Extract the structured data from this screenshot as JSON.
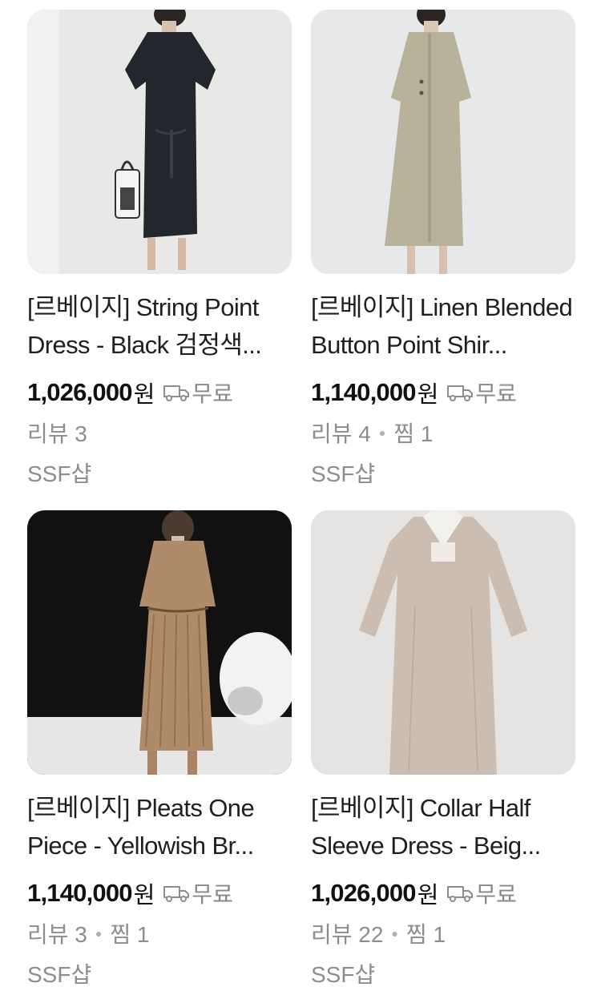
{
  "products": [
    {
      "title": "[르베이지] String Point Dress - Black 검정색...",
      "price": "1,026,000",
      "currency": "원",
      "shipping": "무료",
      "reviews": "리뷰 3",
      "likes": "",
      "store": "SSF샵",
      "image": "black-dress-photo"
    },
    {
      "title": "[르베이지] Linen Blended Button Point Shir...",
      "price": "1,140,000",
      "currency": "원",
      "shipping": "무료",
      "reviews": "리뷰 4",
      "likes": "찜 1",
      "store": "SSF샵",
      "image": "sage-linen-dress-photo"
    },
    {
      "title": "[르베이지] Pleats One Piece - Yellowish Br...",
      "price": "1,140,000",
      "currency": "원",
      "shipping": "무료",
      "reviews": "리뷰 3",
      "likes": "찜 1",
      "store": "SSF샵",
      "image": "pleated-brown-dress-photo"
    },
    {
      "title": "[르베이지] Collar Half Sleeve Dress - Beig...",
      "price": "1,026,000",
      "currency": "원",
      "shipping": "무료",
      "reviews": "리뷰 22",
      "likes": "찜 1",
      "store": "SSF샵",
      "image": "beige-collar-dress-photo"
    }
  ],
  "icons": {
    "shipping": "truck-icon"
  },
  "colors": {
    "price": "#111111",
    "muted": "#8d8d8d",
    "thumb_bg": "#e9e9ea"
  }
}
